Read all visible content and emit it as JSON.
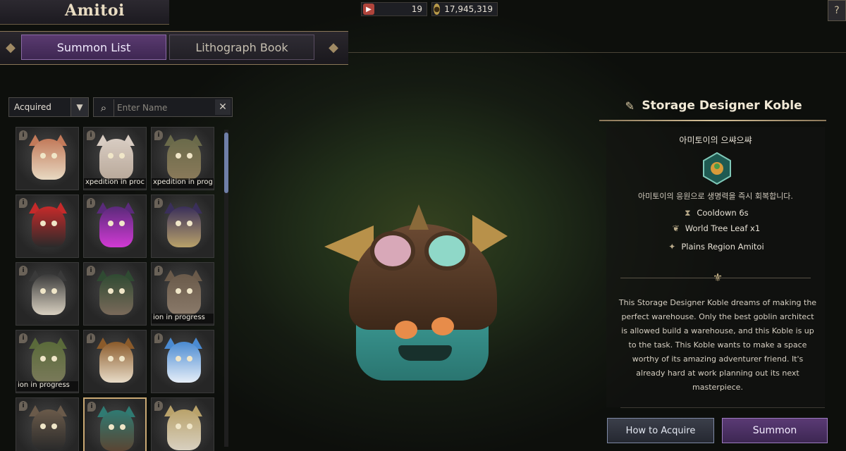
{
  "header": {
    "title": "Amitoi",
    "tabs": [
      {
        "label": "Summon List",
        "active": true
      },
      {
        "label": "Lithograph Book",
        "active": false
      }
    ]
  },
  "currency": [
    {
      "icon": "ticket-icon",
      "value": "19"
    },
    {
      "icon": "gold-coin-icon",
      "value": "17,945,319"
    }
  ],
  "filters": {
    "dropdown_value": "Acquired",
    "search_placeholder": "Enter Name"
  },
  "grid": {
    "cells": [
      {
        "status": "",
        "colors": [
          "#c27a5a",
          "#e8d9c2"
        ]
      },
      {
        "status": "xpedition in proc",
        "colors": [
          "#d8ccc2",
          "#b9a99a"
        ]
      },
      {
        "status": "xpedition in prog",
        "colors": [
          "#6a6a4a",
          "#8a7a5a"
        ]
      },
      {
        "status": "",
        "colors": [
          "#c52a2a",
          "#2a2a2a"
        ]
      },
      {
        "status": "",
        "colors": [
          "#5a2a7a",
          "#d13ad4"
        ]
      },
      {
        "status": "",
        "colors": [
          "#3a2f5a",
          "#b9a26a"
        ]
      },
      {
        "status": "",
        "colors": [
          "#3a3a3a",
          "#d8d0c0"
        ]
      },
      {
        "status": "",
        "colors": [
          "#2f4a32",
          "#7a6a5a"
        ]
      },
      {
        "status": "ion in progress",
        "colors": [
          "#6a5a4a",
          "#8a7a6a"
        ]
      },
      {
        "status": "ion in progress",
        "colors": [
          "#5a6a3a",
          "#7a7a5a"
        ]
      },
      {
        "status": "",
        "colors": [
          "#8a5a2a",
          "#e8dcc8"
        ]
      },
      {
        "status": "",
        "colors": [
          "#4a8ad1",
          "#e6eef8"
        ]
      },
      {
        "status": "",
        "colors": [
          "#6a5a4a",
          "#2a2a2a"
        ]
      },
      {
        "status": "",
        "colors": [
          "#2f7a72",
          "#5a4533"
        ],
        "selected": true
      },
      {
        "status": "",
        "colors": [
          "#b9a26a",
          "#d8d0c0"
        ]
      }
    ]
  },
  "detail": {
    "name": "Storage Designer Koble",
    "skill_name": "아미토이의 으쌰으쌰",
    "skill_description": "아미토이의 응원으로 생명력을 즉시 회복합니다.",
    "stats": [
      {
        "icon": "hourglass-icon",
        "label": "Cooldown 6s"
      },
      {
        "icon": "leaf-icon",
        "label": "World Tree Leaf x1"
      },
      {
        "icon": "region-icon",
        "label": "Plains Region Amitoi"
      }
    ],
    "flavor_text": "This Storage Designer Koble dreams of making the perfect warehouse. Only the best goblin architect is allowed build a warehouse, and this Koble is up to the task. This Koble wants to make a space worthy of its amazing adventurer friend. It's already hard at work planning out its next masterpiece."
  },
  "actions": {
    "acquire_label": "How to Acquire",
    "summon_label": "Summon"
  }
}
